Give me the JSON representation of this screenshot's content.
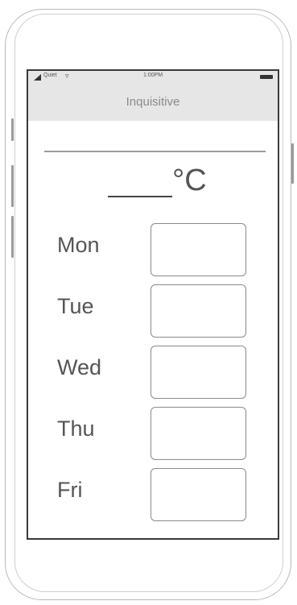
{
  "status_bar": {
    "carrier": "Quiet",
    "time": "1:00PM",
    "icons": [
      "signal-icon",
      "wifi-icon",
      "battery-icon"
    ]
  },
  "app": {
    "title": "Inquisitive"
  },
  "temperature": {
    "value": "",
    "unit": "°C"
  },
  "days": [
    {
      "label": "Mon",
      "value": ""
    },
    {
      "label": "Tue",
      "value": ""
    },
    {
      "label": "Wed",
      "value": ""
    },
    {
      "label": "Thu",
      "value": ""
    },
    {
      "label": "Fri",
      "value": ""
    }
  ],
  "colors": {
    "screen_border": "#3a3a3a",
    "status_bar_bg": "#e6e6e6",
    "text": "#555555"
  }
}
